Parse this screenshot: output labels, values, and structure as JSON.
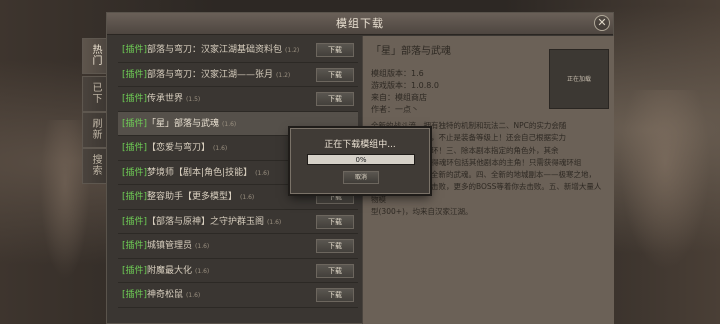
{
  "window": {
    "title": "模组下载",
    "close_glyph": "✕"
  },
  "side_tabs": [
    {
      "label": [
        "热",
        "门"
      ]
    },
    {
      "label": [
        "已",
        "下"
      ]
    },
    {
      "label": [
        "刷",
        "新"
      ]
    },
    {
      "label": [
        "搜",
        "索"
      ]
    }
  ],
  "list": [
    {
      "tag": "[插件]",
      "name": "部落与弯刀：汉家江湖基础资料包",
      "version": "(1.2)",
      "button": "下载"
    },
    {
      "tag": "[插件]",
      "name": "部落与弯刀：汉家江湖——张月",
      "version": "(1.2)",
      "button": "下载"
    },
    {
      "tag": "[插件]",
      "name": "传承世界",
      "version": "(1.5)",
      "button": "下载"
    },
    {
      "tag": "[插件]",
      "name": "「星」部落与武魂",
      "version": "(1.6)",
      "button": "",
      "selected": true
    },
    {
      "tag": "[插件]",
      "name": "【恋爱与弯刀】",
      "version": "(1.6)",
      "button": ""
    },
    {
      "tag": "[插件]",
      "name": "梦境师【剧本|角色|技能】",
      "version": "(1.6)",
      "button": ""
    },
    {
      "tag": "[插件]",
      "name": "整容助手【更多模型】",
      "version": "(1.6)",
      "button": "下载"
    },
    {
      "tag": "[插件]",
      "name": "【部落与原神】之守护群玉阁",
      "version": "(1.6)",
      "button": "下载"
    },
    {
      "tag": "[插件]",
      "name": "城镇管理员",
      "version": "(1.6)",
      "button": "下载"
    },
    {
      "tag": "[插件]",
      "name": "附魔最大化",
      "version": "(1.6)",
      "button": "下载"
    },
    {
      "tag": "[插件]",
      "name": "神奇松鼠",
      "version": "(1.6)",
      "button": "下载"
    }
  ],
  "detail": {
    "title": "「星」部落与武魂",
    "mod_version": "模组版本：1.6",
    "game_version": "游戏版本：1.0.8.0",
    "source": "来自：模组商店",
    "author": "作者：一点丶",
    "thumb_text": "正在加载",
    "description": [
      "全新的战斗流，拥有独特的机制和玩法二、NPC的实力会随",
      "着你的成长而成长，不止是装备等级上！还会自己根据实力",
      "去学习更强大的魂环！三、除本剧本指定的角色外，其余",
      "所有NPC都可以获得魂环包括其他剧本的主角！只需获得魂环组",
      "合的流派即可使用全新的武魂。四、全新的地城副本——极寒之地，",
      "需要一定实力才可击败，更多的BOSS等着你去击败。五、新增大量人物模",
      "型(300+)，均来自汉家江湖。"
    ]
  },
  "modal": {
    "title": "正在下载模组中...",
    "progress": 0,
    "progress_text": "0%",
    "cancel": "取消"
  }
}
